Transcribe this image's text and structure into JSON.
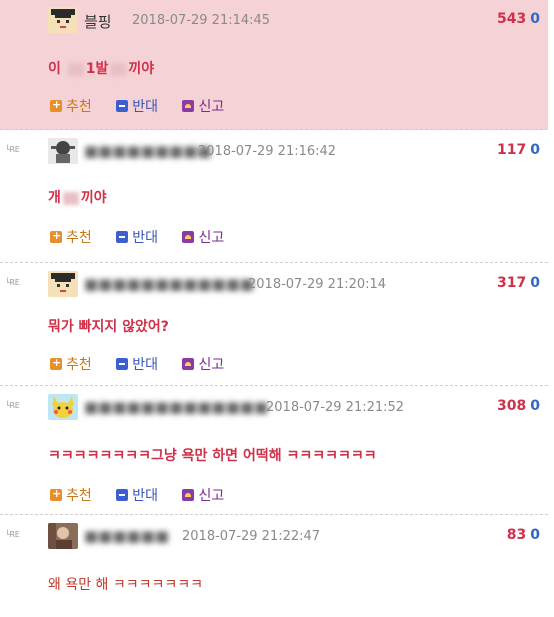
{
  "comments": [
    {
      "nick": "블핑",
      "nick_blurred": false,
      "date": "2018-07-29 21:14:45",
      "up": "543",
      "down": "0",
      "body_parts": [
        "이",
        "1발",
        "끼야"
      ],
      "avatar": "graduation-cap-avatar",
      "best": true,
      "show_actions": true
    },
    {
      "nick": "",
      "nick_blurred": true,
      "date": "2018-07-29 21:16:42",
      "up": "117",
      "down": "0",
      "body_parts": [
        "개",
        "",
        "끼야"
      ],
      "avatar": "character-avatar",
      "best": false,
      "show_actions": true
    },
    {
      "nick": "",
      "nick_blurred": true,
      "date": "2018-07-29 21:20:14",
      "up": "317",
      "down": "0",
      "body": "뭐가 빠지지 않았어?",
      "avatar": "graduation-cap-avatar",
      "best": false,
      "show_actions": true
    },
    {
      "nick": "",
      "nick_blurred": true,
      "date": "2018-07-29 21:21:52",
      "up": "308",
      "down": "0",
      "body": "ㅋㅋㅋㅋㅋㅋㅋㅋ그냥 욕만 하면 어떡해 ㅋㅋㅋㅋㅋㅋㅋ",
      "avatar": "pikachu-avatar",
      "best": false,
      "show_actions": true
    },
    {
      "nick": "",
      "nick_blurred": true,
      "date": "2018-07-29 21:22:47",
      "up": "83",
      "down": "0",
      "body": "왜 욕만 해 ㅋㅋㅋㅋㅋㅋㅋ",
      "avatar": "photo-avatar",
      "best": false,
      "show_actions": false
    }
  ],
  "actions": {
    "recommend": "추천",
    "oppose": "반대",
    "report": "신고"
  },
  "reply_tag": "└RE",
  "colors": {
    "best_bg": "#f4d2d5",
    "up": "#d0314a",
    "down": "#2f68c6",
    "body": "#d0314a"
  }
}
